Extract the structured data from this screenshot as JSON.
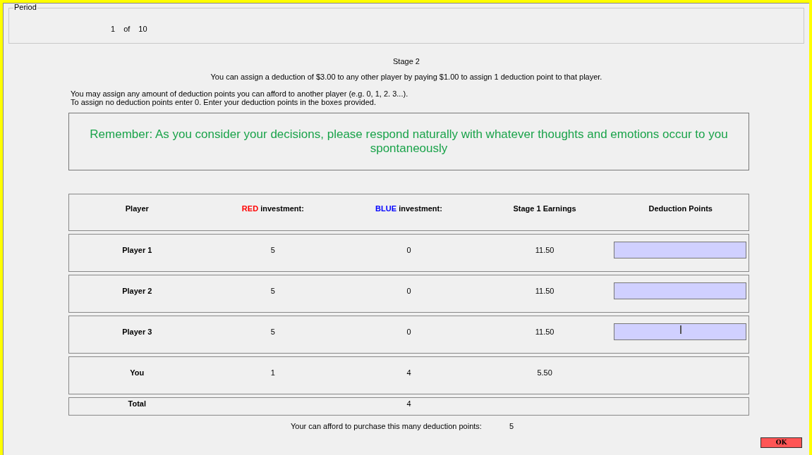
{
  "period": {
    "legend": "Period",
    "current": "1",
    "of": "of",
    "total": "10"
  },
  "stage_title": "Stage 2",
  "rule_text": "You can assign a deduction of $3.00 to any other player by paying $1.00 to assign 1 deduction point to that player.",
  "instructions": [
    "You may assign any amount of deduction points you can afford to another player (e.g. 0, 1, 2. 3...).",
    "To assign no deduction points enter 0.  Enter your deduction points in the boxes provided."
  ],
  "reminder": "Remember: As you consider your decisions, please respond naturally with whatever thoughts and emotions occur to you spontaneously",
  "table": {
    "columns": [
      {
        "label": "Player"
      },
      {
        "accent": "RED",
        "color": "#ff0000",
        "label": "investment:"
      },
      {
        "accent": "BLUE",
        "color": "#0000ff",
        "label": "investment:"
      },
      {
        "label": "Stage 1 Earnings"
      },
      {
        "label": "Deduction Points"
      }
    ],
    "rows": [
      {
        "player": "Player 1",
        "red": "5",
        "blue": "0",
        "earnings": "11.50",
        "input": {
          "focused": false
        }
      },
      {
        "player": "Player 2",
        "red": "5",
        "blue": "0",
        "earnings": "11.50",
        "input": {
          "focused": false
        }
      },
      {
        "player": "Player 3",
        "red": "5",
        "blue": "0",
        "earnings": "11.50",
        "input": {
          "focused": true
        }
      },
      {
        "player": "You",
        "red": "1",
        "blue": "4",
        "earnings": "5.50"
      }
    ],
    "total": {
      "label": "Total",
      "blue": "4"
    }
  },
  "afford": {
    "label": "Your can afford to purchase this many deduction points:",
    "value": "5"
  },
  "ok_button": "OK"
}
